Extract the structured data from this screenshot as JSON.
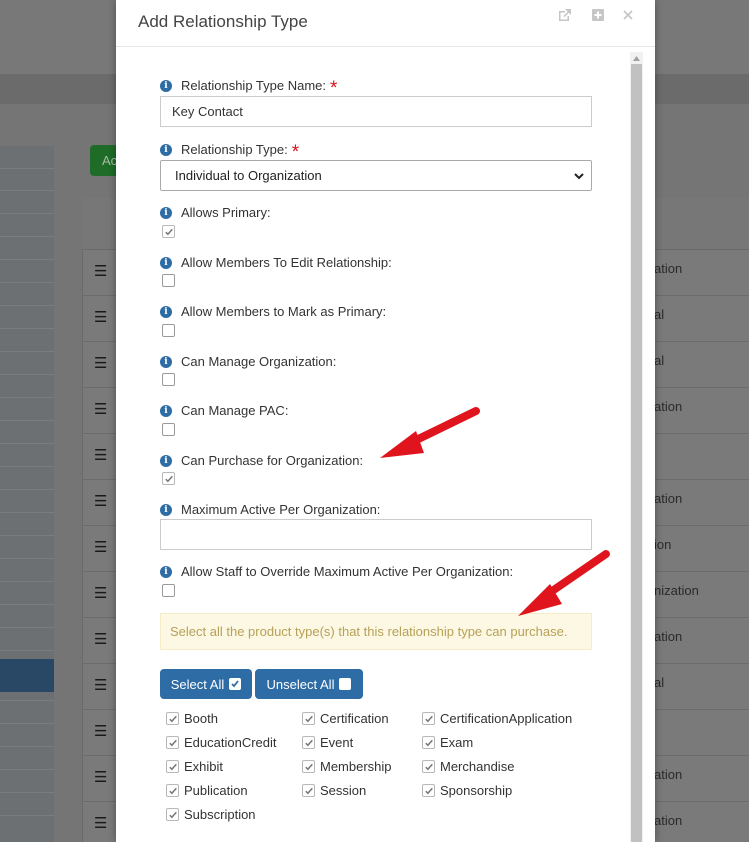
{
  "background": {
    "green_button_label": "Ac",
    "table_cells": [
      "ation",
      "al",
      "al",
      "ation",
      "",
      "ation",
      "ion",
      "nization",
      "ation",
      "al",
      "",
      "ation",
      "ation"
    ]
  },
  "modal": {
    "title": "Add Relationship Type",
    "fields": {
      "name_label": "Relationship Type Name:",
      "name_value": "Key Contact",
      "type_label": "Relationship Type:",
      "type_value": "Individual to Organization",
      "allows_primary_label": "Allows Primary:",
      "allow_edit_label": "Allow Members To Edit Relationship:",
      "allow_mark_primary_label": "Allow Members to Mark as Primary:",
      "can_manage_org_label": "Can Manage Organization:",
      "can_manage_pac_label": "Can Manage PAC:",
      "can_purchase_label": "Can Purchase for Organization:",
      "max_active_label": "Maximum Active Per Organization:",
      "max_active_value": "",
      "allow_override_label": "Allow Staff to Override Maximum Active Per Organization:"
    },
    "checked": {
      "allows_primary": true,
      "allow_edit": false,
      "allow_mark_primary": false,
      "can_manage_org": false,
      "can_manage_pac": false,
      "can_purchase": true,
      "allow_override": false
    },
    "notice": "Select all the product type(s) that this relationship type can purchase.",
    "select_all_label": "Select All",
    "unselect_all_label": "Unselect All",
    "product_types": [
      {
        "label": "Booth",
        "checked": true
      },
      {
        "label": "Certification",
        "checked": true
      },
      {
        "label": "CertificationApplication",
        "checked": true
      },
      {
        "label": "EducationCredit",
        "checked": true
      },
      {
        "label": "Event",
        "checked": true
      },
      {
        "label": "Exam",
        "checked": true
      },
      {
        "label": "Exhibit",
        "checked": true
      },
      {
        "label": "Membership",
        "checked": true
      },
      {
        "label": "Merchandise",
        "checked": true
      },
      {
        "label": "Publication",
        "checked": true
      },
      {
        "label": "Session",
        "checked": true
      },
      {
        "label": "Sponsorship",
        "checked": true
      },
      {
        "label": "Subscription",
        "checked": true
      }
    ]
  },
  "colors": {
    "accent": "#2d6ca4",
    "required": "#d9141c",
    "annotation_arrow": "#e0141c",
    "notice_bg": "#fcf8e3",
    "notice_text": "#b7a058"
  }
}
